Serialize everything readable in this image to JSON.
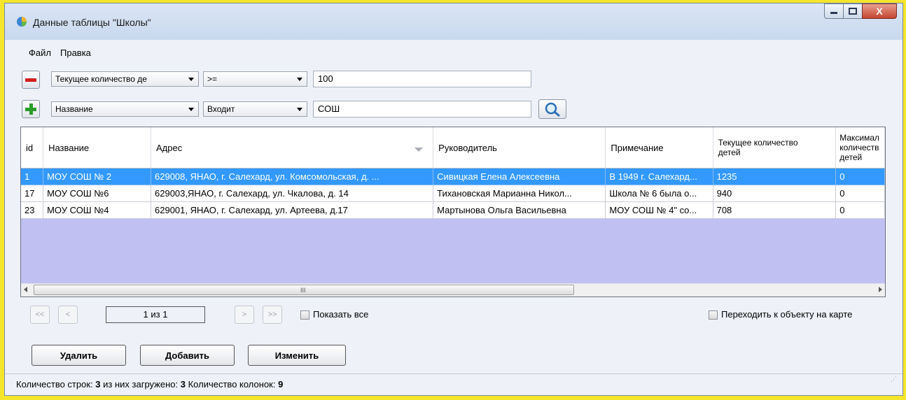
{
  "window": {
    "title": "Данные таблицы \"Школы\"",
    "close_glyph": "X"
  },
  "menu": {
    "items": [
      "Файл",
      "Правка"
    ]
  },
  "filters": [
    {
      "field": "Текущее количество де",
      "operator": ">=",
      "value": "100",
      "button": "remove"
    },
    {
      "field": "Название",
      "operator": "Входит",
      "value": "СОШ",
      "button": "add"
    }
  ],
  "table": {
    "columns": [
      "id",
      "Название",
      "Адрес",
      "Руководитель",
      "Примечание",
      "Текущее количество детей",
      "Максимал количеств детей"
    ],
    "rows": [
      {
        "id": "1",
        "name": "МОУ СОШ № 2",
        "address": "629008, ЯНАО, г. Салехард, ул. Комсомольская, д. ...",
        "head": "Сивицкая Елена Алексеевна",
        "note": "В 1949 г. Салехард...",
        "current": "1235",
        "max": "0",
        "selected": true
      },
      {
        "id": "17",
        "name": "МОУ СОШ №6",
        "address": "629003,ЯНАО, г. Салехард, ул. Чкалова, д. 14",
        "head": "Тихановская Марианна Никол...",
        "note": "Школа № 6 была о...",
        "current": "940",
        "max": "0",
        "selected": false
      },
      {
        "id": "23",
        "name": "МОУ СОШ №4",
        "address": "629001, ЯНАО, г. Салехард, ул. Артеева, д.17",
        "head": "Мартынова Ольга Васильевна",
        "note": "МОУ СОШ № 4\" co...",
        "current": "708",
        "max": "0",
        "selected": false
      }
    ]
  },
  "scrollbar": {
    "grip": "III"
  },
  "pager": {
    "first": "<<",
    "prev": "<",
    "page": "1 из 1",
    "next": ">",
    "last": ">>",
    "show_all": "Показать все",
    "goto_map": "Переходить к объекту на карте"
  },
  "actions": {
    "delete": "Удалить",
    "add": "Добавить",
    "edit": "Изменить"
  },
  "status": {
    "rows_label": "Количество строк:",
    "rows_value": "3",
    "loaded_label": "из них загружено:",
    "loaded_value": "3",
    "cols_label": "Количество колонок:",
    "cols_value": "9"
  },
  "colors": {
    "selected_row": "#3399ff",
    "empty_area": "#c0c1f2",
    "screen_bg": "#f5e62b"
  }
}
